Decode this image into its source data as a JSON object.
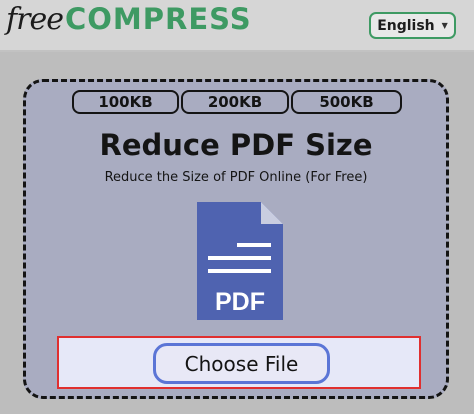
{
  "brand": {
    "prefix": "free",
    "name": "COMPRESS"
  },
  "language": {
    "label": "English",
    "caret_icon": "caret-down-icon"
  },
  "sizes": [
    "100KB",
    "200KB",
    "500KB"
  ],
  "hero": {
    "title": "Reduce PDF Size",
    "subtitle": "Reduce the Size of PDF Online (For Free)",
    "icon": "pdf-file-icon",
    "icon_text": "PDF"
  },
  "upload": {
    "button_label": "Choose File"
  },
  "colors": {
    "brand_green": "#3e9a63",
    "card_bg": "#a9acc1",
    "pdf_blue": "#4f63b0",
    "upload_border": "#e02f2f",
    "button_border": "#5b75d6"
  }
}
